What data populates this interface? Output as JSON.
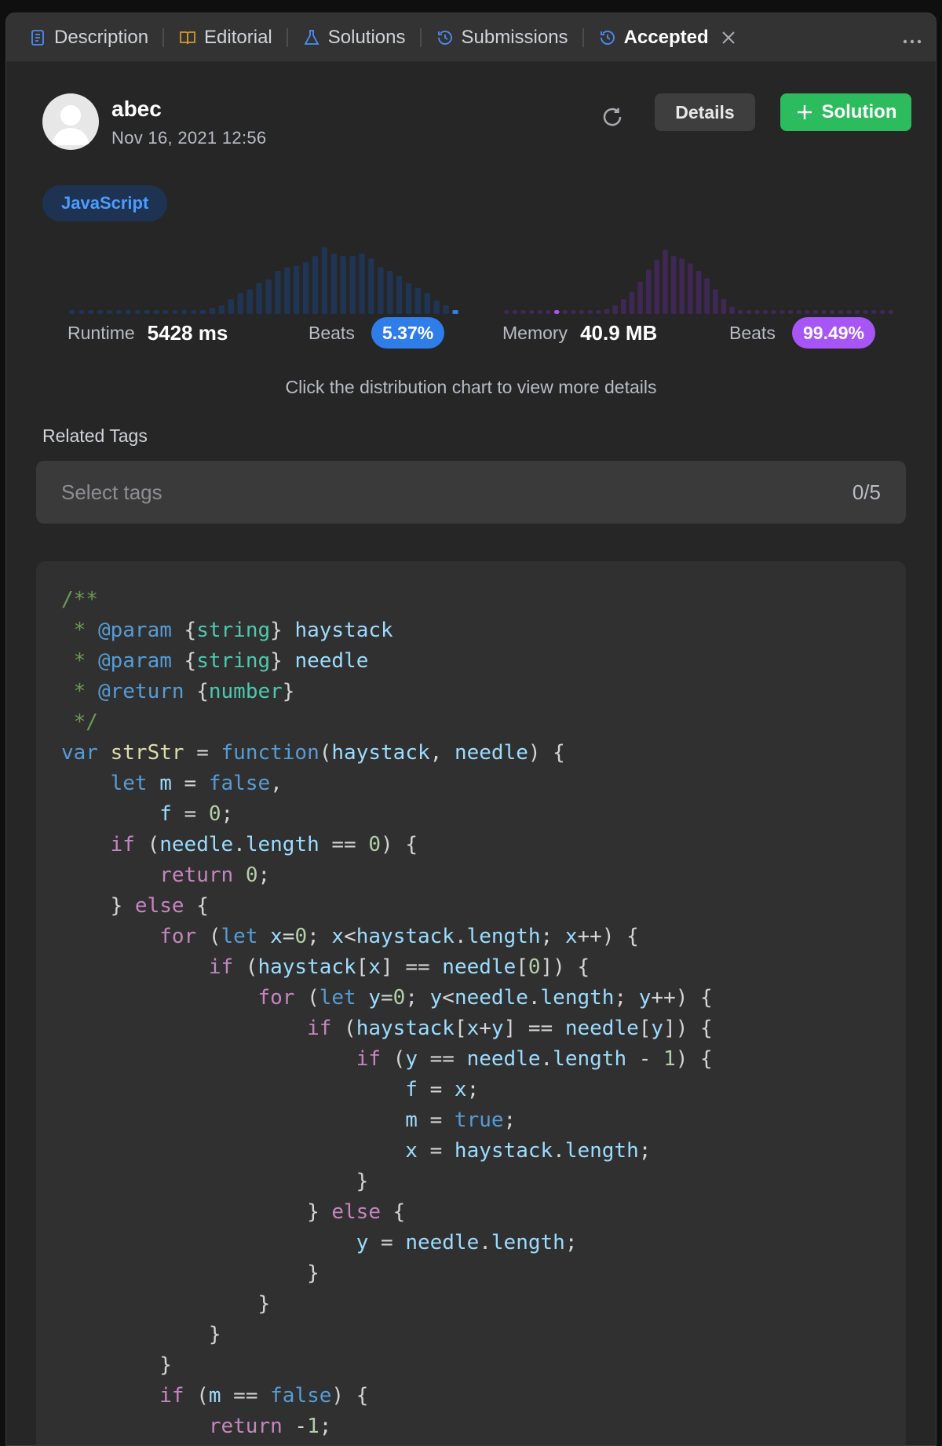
{
  "tabs": [
    {
      "label": "Description",
      "icon": "description-icon"
    },
    {
      "label": "Editorial",
      "icon": "book-icon"
    },
    {
      "label": "Solutions",
      "icon": "flask-icon"
    },
    {
      "label": "Submissions",
      "icon": "history-icon"
    },
    {
      "label": "Accepted",
      "icon": "history-icon",
      "active": true
    }
  ],
  "user": {
    "name": "abec",
    "timestamp": "Nov 16, 2021 12:56"
  },
  "buttons": {
    "details": "Details",
    "solution": "Solution"
  },
  "language": "JavaScript",
  "runtime": {
    "label": "Runtime",
    "value": "5428 ms",
    "beats_label": "Beats",
    "beats": "5.37%",
    "color": "#2f7de9"
  },
  "memory": {
    "label": "Memory",
    "value": "40.9 MB",
    "beats_label": "Beats",
    "beats": "99.49%",
    "color": "#a855f7"
  },
  "hint": "Click the distribution chart to view more details",
  "tags": {
    "label": "Related Tags",
    "placeholder": "Select tags",
    "count": "0/5"
  },
  "chart_data": [
    {
      "type": "bar",
      "series": [
        {
          "values": [
            1,
            1,
            1,
            1,
            1,
            1,
            1,
            1,
            1,
            1,
            1,
            1,
            1,
            1,
            1.5,
            2.5,
            3.5,
            6,
            8.5,
            10,
            12.5,
            14,
            17.5,
            19,
            19.5,
            21,
            23.5,
            27,
            24.5,
            23.5,
            23.5,
            24.5,
            22.5,
            19,
            17.5,
            15.5,
            12.5,
            10.5,
            8.5,
            5.5,
            3.5,
            1.5
          ]
        }
      ],
      "highlight_index": 41,
      "highlight_color": "#2f7de9"
    },
    {
      "type": "bar",
      "series": [
        {
          "values": [
            1,
            1,
            1,
            1,
            1,
            1,
            1,
            1,
            1,
            1,
            1,
            1,
            2,
            3.5,
            6,
            9,
            13,
            18,
            22,
            26,
            23.5,
            22.5,
            20.5,
            17.5,
            14.5,
            10,
            6,
            3,
            1.5,
            1,
            1,
            1,
            1,
            1,
            1,
            1,
            1,
            1,
            1,
            1,
            1,
            1,
            1,
            1,
            1,
            1,
            1
          ]
        }
      ],
      "highlight_index": 6,
      "highlight_color": "#a855f7"
    }
  ],
  "code": [
    [
      [
        "c",
        "/**"
      ]
    ],
    [
      [
        "c",
        " * "
      ],
      [
        "ck",
        "@param"
      ],
      [
        "p",
        " {"
      ],
      [
        "ct",
        "string"
      ],
      [
        "p",
        "} "
      ],
      [
        "v",
        "haystack"
      ]
    ],
    [
      [
        "c",
        " * "
      ],
      [
        "ck",
        "@param"
      ],
      [
        "p",
        " {"
      ],
      [
        "ct",
        "string"
      ],
      [
        "p",
        "} "
      ],
      [
        "v",
        "needle"
      ]
    ],
    [
      [
        "c",
        " * "
      ],
      [
        "ck",
        "@return"
      ],
      [
        "p",
        " {"
      ],
      [
        "ct",
        "number"
      ],
      [
        "p",
        "}"
      ]
    ],
    [
      [
        "c",
        " */"
      ]
    ],
    [
      [
        "kw",
        "var"
      ],
      [
        "p",
        " "
      ],
      [
        "fn",
        "strStr"
      ],
      [
        "p",
        " = "
      ],
      [
        "kw",
        "function"
      ],
      [
        "p",
        "("
      ],
      [
        "v",
        "haystack"
      ],
      [
        "p",
        ", "
      ],
      [
        "v",
        "needle"
      ],
      [
        "p",
        ") {"
      ]
    ],
    [
      [
        "p",
        "    "
      ],
      [
        "kw",
        "let"
      ],
      [
        "p",
        " "
      ],
      [
        "v",
        "m"
      ],
      [
        "p",
        " = "
      ],
      [
        "kw",
        "false"
      ],
      [
        "p",
        ","
      ]
    ],
    [
      [
        "p",
        "        "
      ],
      [
        "v",
        "f"
      ],
      [
        "p",
        " = "
      ],
      [
        "n",
        "0"
      ],
      [
        "p",
        ";"
      ]
    ],
    [
      [
        "p",
        "    "
      ],
      [
        "ctl",
        "if"
      ],
      [
        "p",
        " ("
      ],
      [
        "v",
        "needle"
      ],
      [
        "p",
        "."
      ],
      [
        "v",
        "length"
      ],
      [
        "p",
        " == "
      ],
      [
        "n",
        "0"
      ],
      [
        "p",
        ") {"
      ]
    ],
    [
      [
        "p",
        "        "
      ],
      [
        "ctl",
        "return"
      ],
      [
        "p",
        " "
      ],
      [
        "n",
        "0"
      ],
      [
        "p",
        ";"
      ]
    ],
    [
      [
        "p",
        "    } "
      ],
      [
        "ctl",
        "else"
      ],
      [
        "p",
        " {"
      ]
    ],
    [
      [
        "p",
        "        "
      ],
      [
        "ctl",
        "for"
      ],
      [
        "p",
        " ("
      ],
      [
        "kw",
        "let"
      ],
      [
        "p",
        " "
      ],
      [
        "v",
        "x"
      ],
      [
        "p",
        "="
      ],
      [
        "n",
        "0"
      ],
      [
        "p",
        "; "
      ],
      [
        "v",
        "x"
      ],
      [
        "p",
        "<"
      ],
      [
        "v",
        "haystack"
      ],
      [
        "p",
        "."
      ],
      [
        "v",
        "length"
      ],
      [
        "p",
        "; "
      ],
      [
        "v",
        "x"
      ],
      [
        "p",
        "++) {"
      ]
    ],
    [
      [
        "p",
        "            "
      ],
      [
        "ctl",
        "if"
      ],
      [
        "p",
        " ("
      ],
      [
        "v",
        "haystack"
      ],
      [
        "p",
        "["
      ],
      [
        "v",
        "x"
      ],
      [
        "p",
        "] == "
      ],
      [
        "v",
        "needle"
      ],
      [
        "p",
        "["
      ],
      [
        "n",
        "0"
      ],
      [
        "p",
        "]) {"
      ]
    ],
    [
      [
        "p",
        "                "
      ],
      [
        "ctl",
        "for"
      ],
      [
        "p",
        " ("
      ],
      [
        "kw",
        "let"
      ],
      [
        "p",
        " "
      ],
      [
        "v",
        "y"
      ],
      [
        "p",
        "="
      ],
      [
        "n",
        "0"
      ],
      [
        "p",
        "; "
      ],
      [
        "v",
        "y"
      ],
      [
        "p",
        "<"
      ],
      [
        "v",
        "needle"
      ],
      [
        "p",
        "."
      ],
      [
        "v",
        "length"
      ],
      [
        "p",
        "; "
      ],
      [
        "v",
        "y"
      ],
      [
        "p",
        "++) {"
      ]
    ],
    [
      [
        "p",
        "                    "
      ],
      [
        "ctl",
        "if"
      ],
      [
        "p",
        " ("
      ],
      [
        "v",
        "haystack"
      ],
      [
        "p",
        "["
      ],
      [
        "v",
        "x"
      ],
      [
        "p",
        "+"
      ],
      [
        "v",
        "y"
      ],
      [
        "p",
        "] == "
      ],
      [
        "v",
        "needle"
      ],
      [
        "p",
        "["
      ],
      [
        "v",
        "y"
      ],
      [
        "p",
        "]) {"
      ]
    ],
    [
      [
        "p",
        "                        "
      ],
      [
        "ctl",
        "if"
      ],
      [
        "p",
        " ("
      ],
      [
        "v",
        "y"
      ],
      [
        "p",
        " == "
      ],
      [
        "v",
        "needle"
      ],
      [
        "p",
        "."
      ],
      [
        "v",
        "length"
      ],
      [
        "p",
        " - "
      ],
      [
        "n",
        "1"
      ],
      [
        "p",
        ") {"
      ]
    ],
    [
      [
        "p",
        "                            "
      ],
      [
        "v",
        "f"
      ],
      [
        "p",
        " = "
      ],
      [
        "v",
        "x"
      ],
      [
        "p",
        ";"
      ]
    ],
    [
      [
        "p",
        "                            "
      ],
      [
        "v",
        "m"
      ],
      [
        "p",
        " = "
      ],
      [
        "kw",
        "true"
      ],
      [
        "p",
        ";"
      ]
    ],
    [
      [
        "p",
        "                            "
      ],
      [
        "v",
        "x"
      ],
      [
        "p",
        " = "
      ],
      [
        "v",
        "haystack"
      ],
      [
        "p",
        "."
      ],
      [
        "v",
        "length"
      ],
      [
        "p",
        ";"
      ]
    ],
    [
      [
        "p",
        "                        }"
      ]
    ],
    [
      [
        "p",
        "                    } "
      ],
      [
        "ctl",
        "else"
      ],
      [
        "p",
        " {"
      ]
    ],
    [
      [
        "p",
        "                        "
      ],
      [
        "v",
        "y"
      ],
      [
        "p",
        " = "
      ],
      [
        "v",
        "needle"
      ],
      [
        "p",
        "."
      ],
      [
        "v",
        "length"
      ],
      [
        "p",
        ";"
      ]
    ],
    [
      [
        "p",
        "                    }"
      ]
    ],
    [
      [
        "p",
        "                }"
      ]
    ],
    [
      [
        "p",
        "            }"
      ]
    ],
    [
      [
        "p",
        "        }"
      ]
    ],
    [
      [
        "p",
        "        "
      ],
      [
        "ctl",
        "if"
      ],
      [
        "p",
        " ("
      ],
      [
        "v",
        "m"
      ],
      [
        "p",
        " == "
      ],
      [
        "kw",
        "false"
      ],
      [
        "p",
        ") {"
      ]
    ],
    [
      [
        "p",
        "            "
      ],
      [
        "ctl",
        "return"
      ],
      [
        "p",
        " -"
      ],
      [
        "n",
        "1"
      ],
      [
        "p",
        ";"
      ]
    ]
  ]
}
